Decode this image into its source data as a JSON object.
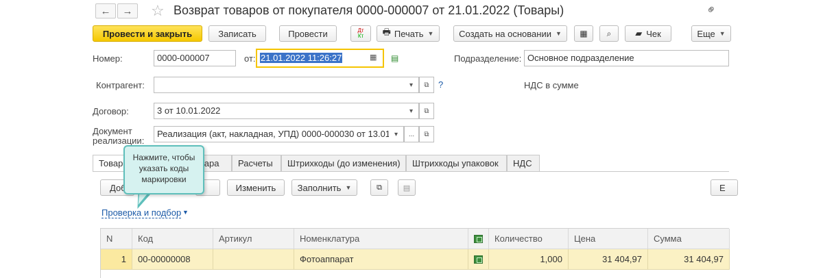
{
  "window": {
    "title": "Возврат товаров от покупателя 0000-000007 от 21.01.2022 (Товары)"
  },
  "nav": {
    "back": "←",
    "forward": "→",
    "star": "☆",
    "link": "⊖"
  },
  "toolbar": {
    "post_close": "Провести и закрыть",
    "save": "Записать",
    "post": "Провести",
    "dtkt": "ДтКт",
    "print": "Печать",
    "create_based": "Создать на основании",
    "check": "Чек",
    "more": "Еще"
  },
  "form": {
    "number_label": "Номер:",
    "number_value": "0000-000007",
    "date_label": "от:",
    "date_value": "21.01.2022 11:26:27",
    "division_label": "Подразделение:",
    "division_value": "Основное подразделение",
    "contractor_label": "Контрагент:",
    "contractor_value": "",
    "help": "?",
    "vat_mode": "НДС в сумме",
    "contract_label": "Договор:",
    "contract_value": "3 от 10.01.2022",
    "doc_label_1": "Документ",
    "doc_label_2": "реализации:",
    "doc_value": "Реализация (акт, накладная, УПД) 0000-000030 от 13.01.",
    "ellipsis": "..."
  },
  "tabs": [
    {
      "label": "Товары",
      "visible": "Товар"
    },
    {
      "label": "Тара",
      "visible": "тара"
    },
    {
      "label": "Расчеты"
    },
    {
      "label": "Штрихкоды (до изменения)"
    },
    {
      "label": "Штрихкоды упаковок"
    },
    {
      "label": "НДС"
    }
  ],
  "table_toolbar": {
    "add": "Доб",
    "pick": "р",
    "change": "Изменить",
    "fill": "Заполнить",
    "more": "Е"
  },
  "check_link": "Проверка и подбор",
  "tooltip": {
    "line1": "Нажмите, чтобы",
    "line2": "указать коды",
    "line3": "маркировки"
  },
  "table": {
    "headers": {
      "n": "N",
      "code": "Код",
      "article": "Артикул",
      "item": "Номенклатура",
      "qty": "Количество",
      "price": "Цена",
      "sum": "Сумма"
    },
    "rows": [
      {
        "n": "1",
        "code": "00-00000008",
        "article": "",
        "item": "Фотоаппарат",
        "qty": "1,000",
        "price": "31 404,97",
        "sum": "31 404,97"
      }
    ]
  }
}
